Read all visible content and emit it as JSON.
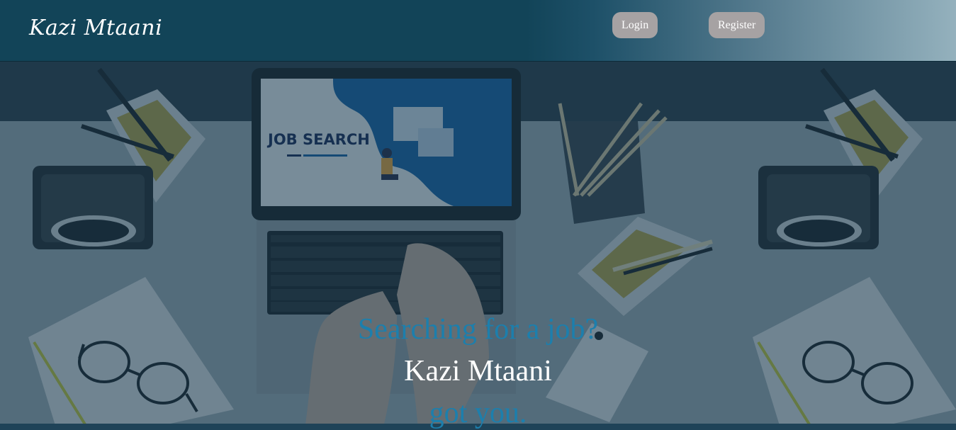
{
  "header": {
    "logo": "Kazi Mtaani",
    "login_label": "Login",
    "register_label": "Register"
  },
  "hero": {
    "line1": "Searching for a job?",
    "line2": "Kazi Mtaani",
    "line3": "got you.",
    "screen_heading": "JOB SEARCH"
  },
  "colors": {
    "header_bg": "#124458",
    "button_bg": "#a6a2a3",
    "accent_blue": "#1c7fad",
    "overlay": "#12344a"
  }
}
